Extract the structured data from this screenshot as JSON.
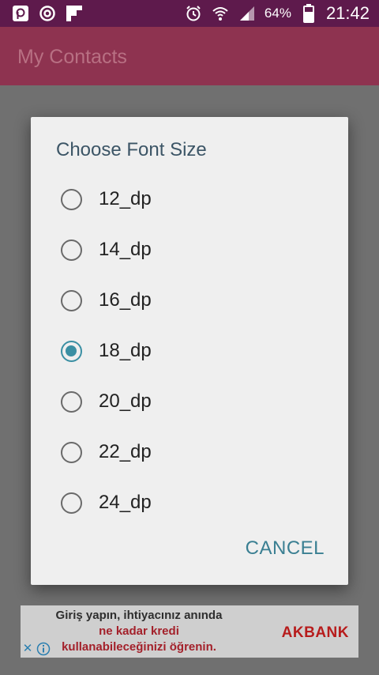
{
  "status_bar": {
    "left_icons": [
      "notification-app-icon",
      "sync-icon",
      "flipboard-icon"
    ],
    "right_icons": [
      "alarm-icon",
      "wifi-icon",
      "signal-icon",
      "battery-icon"
    ],
    "battery_percent": "64%",
    "time": "21:42"
  },
  "app_bar": {
    "title": "My Contacts"
  },
  "dialog": {
    "title": "Choose Font Size",
    "options": [
      {
        "label": "12_dp",
        "checked": false
      },
      {
        "label": "14_dp",
        "checked": false
      },
      {
        "label": "16_dp",
        "checked": false
      },
      {
        "label": "18_dp",
        "checked": true
      },
      {
        "label": "20_dp",
        "checked": false
      },
      {
        "label": "22_dp",
        "checked": false
      },
      {
        "label": "24_dp",
        "checked": false
      }
    ],
    "cancel_label": "CANCEL"
  },
  "ad": {
    "line1": "Giriş yapın, ihtiyacınız anında",
    "line2": "ne kadar kredi",
    "line3": "kullanabileceğinizi öğrenin.",
    "brand": "AKBANK"
  },
  "colors": {
    "status_bar": "#5e1a4c",
    "app_bar": "#8e3350",
    "accent": "#3a8fa3"
  }
}
